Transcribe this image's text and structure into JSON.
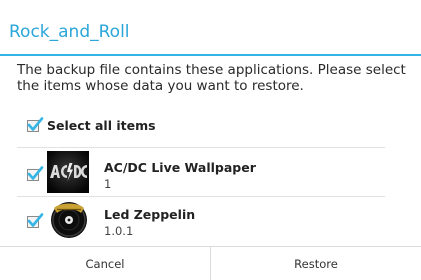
{
  "dialog": {
    "title": "Rock_and_Roll",
    "message": "The backup file contains these applications. Please select the items whose data you want to restore.",
    "select_all": {
      "label": "Select all items",
      "checked": true
    },
    "apps": [
      {
        "name": "AC/DC Live Wallpaper",
        "version": "1",
        "checked": true,
        "icon": "acdc-logo-icon"
      },
      {
        "name": "Led Zeppelin",
        "version": "1.0.1",
        "checked": true,
        "icon": "led-zeppelin-logo-icon"
      }
    ],
    "buttons": {
      "cancel": "Cancel",
      "restore": "Restore"
    }
  },
  "colors": {
    "accent": "#33b5e5",
    "title": "#2aa6d8",
    "checkmark": "#33b5e5",
    "divider": "#dcdcdc"
  }
}
